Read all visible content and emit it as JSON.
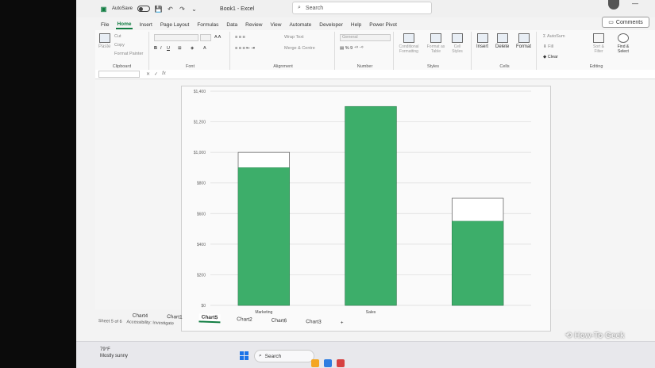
{
  "window": {
    "autosave_label": "AutoSave",
    "book_title": "Book1 - Excel",
    "search_placeholder": "Search",
    "comments_label": "Comments"
  },
  "tabs": [
    "File",
    "Home",
    "Insert",
    "Page Layout",
    "Formulas",
    "Data",
    "Review",
    "View",
    "Automate",
    "Developer",
    "Help",
    "Power Pivot"
  ],
  "active_tab": "Home",
  "ribbon": {
    "clipboard": {
      "label": "Clipboard",
      "paste": "Paste",
      "cut": "Cut",
      "copy": "Copy",
      "format_painter": "Format Painter"
    },
    "font": {
      "label": "Font"
    },
    "alignment": {
      "label": "Alignment",
      "wrap_text": "Wrap Text",
      "merge_center": "Merge & Centre"
    },
    "number": {
      "label": "Number",
      "format": "General"
    },
    "styles": {
      "label": "Styles",
      "conditional": "Conditional Formatting",
      "format_table": "Format as Table",
      "cell_styles": "Cell Styles"
    },
    "cells": {
      "label": "Cells",
      "insert": "Insert",
      "delete": "Delete",
      "format": "Format"
    },
    "editing": {
      "label": "Editing",
      "autosum": "AutoSum",
      "fill": "Fill",
      "clear": "Clear",
      "sort_filter": "Sort & Filter",
      "find_select": "Find & Select"
    }
  },
  "formula_bar": {
    "fx": "fx"
  },
  "chart_data": {
    "type": "bar",
    "categories": [
      "Marketing",
      "Sales",
      ""
    ],
    "series": [
      {
        "values": [
          900,
          1300,
          550
        ]
      },
      {
        "values": [
          1000,
          1300,
          700
        ]
      }
    ],
    "ylim": [
      0,
      1400
    ],
    "yticks": [
      "$0",
      "$200",
      "$400",
      "$600",
      "$800",
      "$1,000",
      "$1,200",
      "$1,400"
    ],
    "bar_color": "#3dae6a",
    "grid": true
  },
  "sheet_tabs": [
    "Chart4",
    "Chart1",
    "Chart5",
    "Chart2",
    "Chart6",
    "Chart3"
  ],
  "active_sheet": "Chart5",
  "status": {
    "sheet": "Sheet 5 of 6",
    "accessibility": "Accessibility: Investigate",
    "weather_temp": "79°F",
    "weather_desc": "Mostly sunny"
  },
  "taskbar": {
    "search_label": "Search"
  },
  "watermark": "How-To Geek"
}
